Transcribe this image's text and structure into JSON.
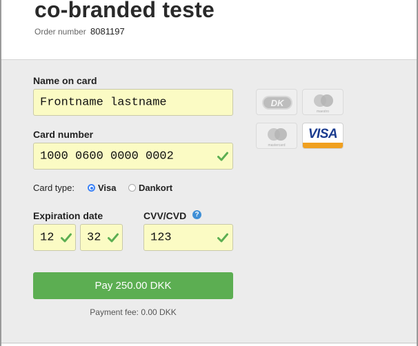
{
  "header": {
    "title": "co-branded teste",
    "order_label": "Order number",
    "order_number": "8081197"
  },
  "form": {
    "name": {
      "label": "Name on card",
      "value": "Frontname lastname"
    },
    "card_number": {
      "label": "Card number",
      "value": "1000 0600 0000 0002"
    },
    "card_type": {
      "label": "Card type:",
      "options": [
        "Visa",
        "Dankort"
      ],
      "selected": "Visa"
    },
    "expiry": {
      "label": "Expiration date",
      "month": "12",
      "year": "32"
    },
    "cvv": {
      "label": "CVV/CVD",
      "value": "123",
      "help": "?"
    },
    "pay_button": "Pay 250.00 DKK",
    "fee": "Payment fee: 0.00 DKK"
  },
  "card_logos": [
    {
      "name": "Dankort",
      "caption": ""
    },
    {
      "name": "Maestro",
      "caption": "maestro"
    },
    {
      "name": "Mastercard",
      "caption": "mastercard"
    },
    {
      "name": "Visa",
      "caption": "VISA"
    }
  ],
  "colors": {
    "field_bg": "#fbfbc4",
    "check": "#5cae52",
    "pay_button": "#5cae52",
    "radio": "#3b82f6",
    "visa_blue": "#1a3b8f"
  }
}
